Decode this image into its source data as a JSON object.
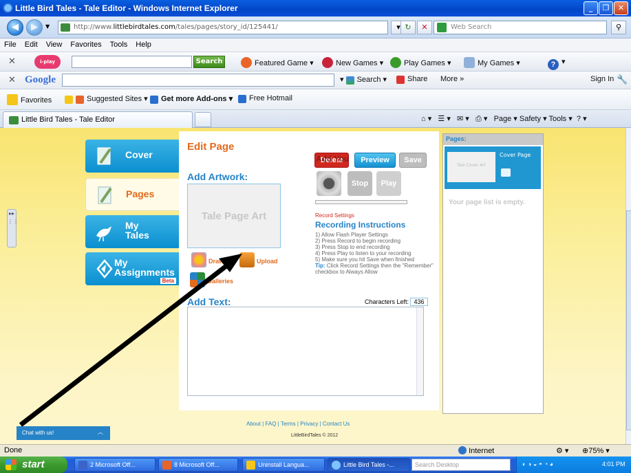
{
  "window": {
    "title": "Little Bird Tales - Tale Editor - Windows Internet Explorer"
  },
  "address_bar": {
    "url_prefix": "http://www.",
    "url_domain": "littlebirdtales.com",
    "url_path": "/tales/pages/story_id/125441/",
    "search_placeholder": "Web Search"
  },
  "menu": [
    "File",
    "Edit",
    "View",
    "Favorites",
    "Tools",
    "Help"
  ],
  "toolbar1": {
    "logo": "i-play",
    "search_button": "Search",
    "items": [
      "Featured Game",
      "New Games",
      "Play Games",
      "My Games"
    ]
  },
  "google_toolbar": {
    "logo": "Google",
    "search": "Search",
    "share": "Share",
    "more": "More »",
    "sign_in": "Sign In"
  },
  "favorites_bar": {
    "favorites": "Favorites",
    "items": [
      "Suggested Sites ▾",
      "Get more Add-ons ▾",
      "Free Hotmail"
    ]
  },
  "tabs": {
    "active": "Little Bird Tales - Tale Editor",
    "commands": "Page ▾   Safety ▾   Tools ▾"
  },
  "left_nav": {
    "cover": "Cover",
    "pages": "Pages",
    "my_tales_1": "My",
    "my_tales_2": "Tales",
    "assignments_1": "My",
    "assignments_2": "Assignments",
    "beta": "Beta"
  },
  "editor": {
    "title": "Edit Page",
    "add_artwork": "Add Artwork:",
    "art_placeholder": "Tale Page Art",
    "draw": "Draw",
    "upload": "Upload",
    "galleries": "Galleries",
    "add_text": "Add Text:",
    "chars_left_label": "Characters Left:",
    "chars_left": "436",
    "delete": "Delete",
    "preview": "Preview",
    "save": "Save",
    "overlap_text": "Add You",
    "stop": "Stop",
    "play": "Play",
    "record_settings": "Record Settings",
    "instructions_title": "Recording Instructions",
    "instructions": [
      "1) Allow Flash Player Settings",
      "2) Press Record to begin recording",
      "3) Press Stop to end recording",
      "4) Press Play to listen to your recording",
      "5) Make sure you hit Save when finished"
    ],
    "tip_label": "Tip:",
    "tip_text": " Click Record Settings then the \"Remember\" checkbox to Always Allow"
  },
  "pages_panel": {
    "header": "Pages:",
    "cover_art": "Tale Cover Art",
    "cover_page": "Cover Page",
    "empty": "Your page list is empty."
  },
  "footer": {
    "links": "About  |  FAQ  |  Terms  |  Privacy  |  Contact Us",
    "copyright": "LittleBirdTales © 2012",
    "chat": "Chat with us!"
  },
  "status_bar": {
    "left": "Done",
    "zone": "Internet",
    "zoom": "75%"
  },
  "taskbar": {
    "start": "start",
    "tasks": [
      "2 Microsoft Off...",
      "8 Microsoft Off...",
      "Uninstall Langua...",
      "Little Bird Tales -..."
    ],
    "search": "Search Desktop",
    "clock": "4:01 PM"
  }
}
